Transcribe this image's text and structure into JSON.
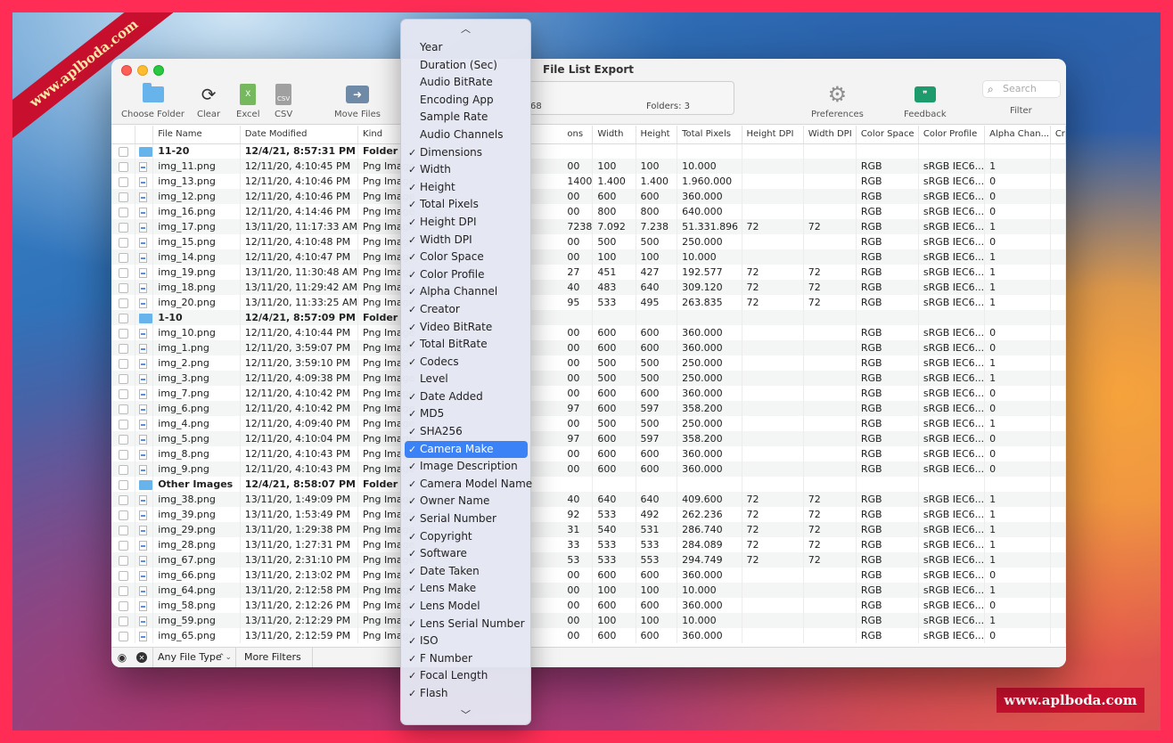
{
  "window": {
    "title": "File List Export"
  },
  "toolbar": {
    "choose_folder": "Choose Folder",
    "clear": "Clear",
    "excel": "Excel",
    "csv": "CSV",
    "move_files": "Move Files",
    "preferences": "Preferences",
    "feedback": "Feedback",
    "filter": "Filter",
    "search_placeholder": "Search",
    "status_files": "68",
    "status_folders": "Folders: 3"
  },
  "table": {
    "columns": [
      "File Name",
      "Date Modified",
      "Kind",
      "ons",
      "Width",
      "Height",
      "Total Pixels",
      "Height DPI",
      "Width DPI",
      "Color Space",
      "Color Profile",
      "Alpha Chan...",
      "Cr"
    ],
    "rows": [
      {
        "type": "folder",
        "name": "11-20",
        "date": "12/4/21, 8:57:31 PM",
        "kind": "Folder",
        "c4": "",
        "w": "",
        "h": "",
        "tp": "",
        "hdpi": "",
        "wdpi": "",
        "cs": "",
        "cp": "",
        "alpha": ""
      },
      {
        "type": "file",
        "name": "img_11.png",
        "date": "12/11/20, 4:10:45 PM",
        "kind": "Png Image",
        "c4": "00",
        "w": "100",
        "h": "100",
        "tp": "10.000",
        "hdpi": "",
        "wdpi": "",
        "cs": "RGB",
        "cp": "sRGB IEC6...",
        "alpha": "1"
      },
      {
        "type": "file",
        "name": "img_13.png",
        "date": "12/11/20, 4:10:46 PM",
        "kind": "Png Image",
        "c4": "1400",
        "w": "1.400",
        "h": "1.400",
        "tp": "1.960.000",
        "hdpi": "",
        "wdpi": "",
        "cs": "RGB",
        "cp": "sRGB IEC6...",
        "alpha": "0"
      },
      {
        "type": "file",
        "name": "img_12.png",
        "date": "12/11/20, 4:10:46 PM",
        "kind": "Png Image",
        "c4": "00",
        "w": "600",
        "h": "600",
        "tp": "360.000",
        "hdpi": "",
        "wdpi": "",
        "cs": "RGB",
        "cp": "sRGB IEC6...",
        "alpha": "0"
      },
      {
        "type": "file",
        "name": "img_16.png",
        "date": "12/11/20, 4:14:46 PM",
        "kind": "Png Image",
        "c4": "00",
        "w": "800",
        "h": "800",
        "tp": "640.000",
        "hdpi": "",
        "wdpi": "",
        "cs": "RGB",
        "cp": "sRGB IEC6...",
        "alpha": "0"
      },
      {
        "type": "file",
        "name": "img_17.png",
        "date": "13/11/20, 11:17:33 AM",
        "kind": "Png Image",
        "c4": "7238",
        "w": "7.092",
        "h": "7.238",
        "tp": "51.331.896",
        "hdpi": "72",
        "wdpi": "72",
        "cs": "RGB",
        "cp": "sRGB IEC6...",
        "alpha": "1"
      },
      {
        "type": "file",
        "name": "img_15.png",
        "date": "12/11/20, 4:10:48 PM",
        "kind": "Png Image",
        "c4": "00",
        "w": "500",
        "h": "500",
        "tp": "250.000",
        "hdpi": "",
        "wdpi": "",
        "cs": "RGB",
        "cp": "sRGB IEC6...",
        "alpha": "0"
      },
      {
        "type": "file",
        "name": "img_14.png",
        "date": "12/11/20, 4:10:47 PM",
        "kind": "Png Image",
        "c4": "00",
        "w": "100",
        "h": "100",
        "tp": "10.000",
        "hdpi": "",
        "wdpi": "",
        "cs": "RGB",
        "cp": "sRGB IEC6...",
        "alpha": "1"
      },
      {
        "type": "file",
        "name": "img_19.png",
        "date": "13/11/20, 11:30:48 AM",
        "kind": "Png Image",
        "c4": "27",
        "w": "451",
        "h": "427",
        "tp": "192.577",
        "hdpi": "72",
        "wdpi": "72",
        "cs": "RGB",
        "cp": "sRGB IEC6...",
        "alpha": "1"
      },
      {
        "type": "file",
        "name": "img_18.png",
        "date": "13/11/20, 11:29:42 AM",
        "kind": "Png Image",
        "c4": "40",
        "w": "483",
        "h": "640",
        "tp": "309.120",
        "hdpi": "72",
        "wdpi": "72",
        "cs": "RGB",
        "cp": "sRGB IEC6...",
        "alpha": "1"
      },
      {
        "type": "file",
        "name": "img_20.png",
        "date": "13/11/20, 11:33:25 AM",
        "kind": "Png Image",
        "c4": "95",
        "w": "533",
        "h": "495",
        "tp": "263.835",
        "hdpi": "72",
        "wdpi": "72",
        "cs": "RGB",
        "cp": "sRGB IEC6...",
        "alpha": "1"
      },
      {
        "type": "folder",
        "name": "1-10",
        "date": "12/4/21, 8:57:09 PM",
        "kind": "Folder",
        "c4": "",
        "w": "",
        "h": "",
        "tp": "",
        "hdpi": "",
        "wdpi": "",
        "cs": "",
        "cp": "",
        "alpha": ""
      },
      {
        "type": "file",
        "name": "img_10.png",
        "date": "12/11/20, 4:10:44 PM",
        "kind": "Png Image",
        "c4": "00",
        "w": "600",
        "h": "600",
        "tp": "360.000",
        "hdpi": "",
        "wdpi": "",
        "cs": "RGB",
        "cp": "sRGB IEC6...",
        "alpha": "0"
      },
      {
        "type": "file",
        "name": "img_1.png",
        "date": "12/11/20, 3:59:07 PM",
        "kind": "Png Image",
        "c4": "00",
        "w": "600",
        "h": "600",
        "tp": "360.000",
        "hdpi": "",
        "wdpi": "",
        "cs": "RGB",
        "cp": "sRGB IEC6...",
        "alpha": "0"
      },
      {
        "type": "file",
        "name": "img_2.png",
        "date": "12/11/20, 3:59:10 PM",
        "kind": "Png Image",
        "c4": "00",
        "w": "500",
        "h": "500",
        "tp": "250.000",
        "hdpi": "",
        "wdpi": "",
        "cs": "RGB",
        "cp": "sRGB IEC6...",
        "alpha": "1"
      },
      {
        "type": "file",
        "name": "img_3.png",
        "date": "12/11/20, 4:09:38 PM",
        "kind": "Png Image",
        "c4": "00",
        "w": "500",
        "h": "500",
        "tp": "250.000",
        "hdpi": "",
        "wdpi": "",
        "cs": "RGB",
        "cp": "sRGB IEC6...",
        "alpha": "1"
      },
      {
        "type": "file",
        "name": "img_7.png",
        "date": "12/11/20, 4:10:42 PM",
        "kind": "Png Image",
        "c4": "00",
        "w": "600",
        "h": "600",
        "tp": "360.000",
        "hdpi": "",
        "wdpi": "",
        "cs": "RGB",
        "cp": "sRGB IEC6...",
        "alpha": "0"
      },
      {
        "type": "file",
        "name": "img_6.png",
        "date": "12/11/20, 4:10:42 PM",
        "kind": "Png Image",
        "c4": "97",
        "w": "600",
        "h": "597",
        "tp": "358.200",
        "hdpi": "",
        "wdpi": "",
        "cs": "RGB",
        "cp": "sRGB IEC6...",
        "alpha": "0"
      },
      {
        "type": "file",
        "name": "img_4.png",
        "date": "12/11/20, 4:09:40 PM",
        "kind": "Png Image",
        "c4": "00",
        "w": "500",
        "h": "500",
        "tp": "250.000",
        "hdpi": "",
        "wdpi": "",
        "cs": "RGB",
        "cp": "sRGB IEC6...",
        "alpha": "1"
      },
      {
        "type": "file",
        "name": "img_5.png",
        "date": "12/11/20, 4:10:04 PM",
        "kind": "Png Image",
        "c4": "97",
        "w": "600",
        "h": "597",
        "tp": "358.200",
        "hdpi": "",
        "wdpi": "",
        "cs": "RGB",
        "cp": "sRGB IEC6...",
        "alpha": "0"
      },
      {
        "type": "file",
        "name": "img_8.png",
        "date": "12/11/20, 4:10:43 PM",
        "kind": "Png Image",
        "c4": "00",
        "w": "600",
        "h": "600",
        "tp": "360.000",
        "hdpi": "",
        "wdpi": "",
        "cs": "RGB",
        "cp": "sRGB IEC6...",
        "alpha": "0"
      },
      {
        "type": "file",
        "name": "img_9.png",
        "date": "12/11/20, 4:10:43 PM",
        "kind": "Png Image",
        "c4": "00",
        "w": "600",
        "h": "600",
        "tp": "360.000",
        "hdpi": "",
        "wdpi": "",
        "cs": "RGB",
        "cp": "sRGB IEC6...",
        "alpha": "0"
      },
      {
        "type": "folder",
        "name": "Other Images",
        "date": "12/4/21, 8:58:07 PM",
        "kind": "Folder",
        "c4": "",
        "w": "",
        "h": "",
        "tp": "",
        "hdpi": "",
        "wdpi": "",
        "cs": "",
        "cp": "",
        "alpha": ""
      },
      {
        "type": "file",
        "name": "img_38.png",
        "date": "13/11/20, 1:49:09 PM",
        "kind": "Png Image",
        "c4": "40",
        "w": "640",
        "h": "640",
        "tp": "409.600",
        "hdpi": "72",
        "wdpi": "72",
        "cs": "RGB",
        "cp": "sRGB IEC6...",
        "alpha": "1"
      },
      {
        "type": "file",
        "name": "img_39.png",
        "date": "13/11/20, 1:53:49 PM",
        "kind": "Png Image",
        "c4": "92",
        "w": "533",
        "h": "492",
        "tp": "262.236",
        "hdpi": "72",
        "wdpi": "72",
        "cs": "RGB",
        "cp": "sRGB IEC6...",
        "alpha": "1"
      },
      {
        "type": "file",
        "name": "img_29.png",
        "date": "13/11/20, 1:29:38 PM",
        "kind": "Png Image",
        "c4": "31",
        "w": "540",
        "h": "531",
        "tp": "286.740",
        "hdpi": "72",
        "wdpi": "72",
        "cs": "RGB",
        "cp": "sRGB IEC6...",
        "alpha": "1"
      },
      {
        "type": "file",
        "name": "img_28.png",
        "date": "13/11/20, 1:27:31 PM",
        "kind": "Png Image",
        "c4": "33",
        "w": "533",
        "h": "533",
        "tp": "284.089",
        "hdpi": "72",
        "wdpi": "72",
        "cs": "RGB",
        "cp": "sRGB IEC6...",
        "alpha": "1"
      },
      {
        "type": "file",
        "name": "img_67.png",
        "date": "13/11/20, 2:31:10 PM",
        "kind": "Png Image",
        "c4": "53",
        "w": "533",
        "h": "553",
        "tp": "294.749",
        "hdpi": "72",
        "wdpi": "72",
        "cs": "RGB",
        "cp": "sRGB IEC6...",
        "alpha": "1"
      },
      {
        "type": "file",
        "name": "img_66.png",
        "date": "13/11/20, 2:13:02 PM",
        "kind": "Png Image",
        "c4": "00",
        "w": "600",
        "h": "600",
        "tp": "360.000",
        "hdpi": "",
        "wdpi": "",
        "cs": "RGB",
        "cp": "sRGB IEC6...",
        "alpha": "0"
      },
      {
        "type": "file",
        "name": "img_64.png",
        "date": "13/11/20, 2:12:58 PM",
        "kind": "Png Image",
        "c4": "00",
        "w": "100",
        "h": "100",
        "tp": "10.000",
        "hdpi": "",
        "wdpi": "",
        "cs": "RGB",
        "cp": "sRGB IEC6...",
        "alpha": "1"
      },
      {
        "type": "file",
        "name": "img_58.png",
        "date": "13/11/20, 2:12:26 PM",
        "kind": "Png Image",
        "c4": "00",
        "w": "600",
        "h": "600",
        "tp": "360.000",
        "hdpi": "",
        "wdpi": "",
        "cs": "RGB",
        "cp": "sRGB IEC6...",
        "alpha": "0"
      },
      {
        "type": "file",
        "name": "img_59.png",
        "date": "13/11/20, 2:12:29 PM",
        "kind": "Png Image",
        "c4": "00",
        "w": "100",
        "h": "100",
        "tp": "10.000",
        "hdpi": "",
        "wdpi": "",
        "cs": "RGB",
        "cp": "sRGB IEC6...",
        "alpha": "1"
      },
      {
        "type": "file",
        "name": "img_65.png",
        "date": "13/11/20, 2:12:59 PM",
        "kind": "Png Image",
        "c4": "00",
        "w": "600",
        "h": "600",
        "tp": "360.000",
        "hdpi": "",
        "wdpi": "",
        "cs": "RGB",
        "cp": "sRGB IEC6...",
        "alpha": "0"
      }
    ]
  },
  "bottom_bar": {
    "file_type": "Any File Type",
    "more_filters": "More Filters"
  },
  "column_menu": {
    "items": [
      {
        "label": "Year",
        "checked": false
      },
      {
        "label": "Duration (Sec)",
        "checked": false
      },
      {
        "label": "Audio BitRate",
        "checked": false
      },
      {
        "label": "Encoding App",
        "checked": false
      },
      {
        "label": "Sample Rate",
        "checked": false
      },
      {
        "label": "Audio Channels",
        "checked": false
      },
      {
        "label": "Dimensions",
        "checked": true
      },
      {
        "label": "Width",
        "checked": true
      },
      {
        "label": "Height",
        "checked": true
      },
      {
        "label": "Total Pixels",
        "checked": true
      },
      {
        "label": "Height DPI",
        "checked": true
      },
      {
        "label": "Width DPI",
        "checked": true
      },
      {
        "label": "Color Space",
        "checked": true
      },
      {
        "label": "Color Profile",
        "checked": true
      },
      {
        "label": "Alpha Channel",
        "checked": true
      },
      {
        "label": "Creator",
        "checked": true
      },
      {
        "label": "Video BitRate",
        "checked": true
      },
      {
        "label": "Total BitRate",
        "checked": true
      },
      {
        "label": "Codecs",
        "checked": true
      },
      {
        "label": "Level",
        "checked": false
      },
      {
        "label": "Date Added",
        "checked": true
      },
      {
        "label": "MD5",
        "checked": true
      },
      {
        "label": "SHA256",
        "checked": true
      },
      {
        "label": "Camera Make",
        "checked": true,
        "highlighted": true
      },
      {
        "label": "Image Description",
        "checked": true
      },
      {
        "label": "Camera Model Name",
        "checked": true
      },
      {
        "label": "Owner Name",
        "checked": true
      },
      {
        "label": "Serial Number",
        "checked": true
      },
      {
        "label": "Copyright",
        "checked": true
      },
      {
        "label": "Software",
        "checked": true
      },
      {
        "label": "Date Taken",
        "checked": true
      },
      {
        "label": "Lens Make",
        "checked": true
      },
      {
        "label": "Lens Model",
        "checked": true
      },
      {
        "label": "Lens Serial Number",
        "checked": true
      },
      {
        "label": "ISO",
        "checked": true
      },
      {
        "label": "F Number",
        "checked": true
      },
      {
        "label": "Focal Length",
        "checked": true
      },
      {
        "label": "Flash",
        "checked": true
      }
    ]
  },
  "watermark": {
    "corner": "www.aplboda.com",
    "bottom": "www.aplboda.com"
  },
  "colors": {
    "accent": "#3b82f6",
    "frame": "#ff2d55",
    "watermark_bg": "#c8102e"
  }
}
